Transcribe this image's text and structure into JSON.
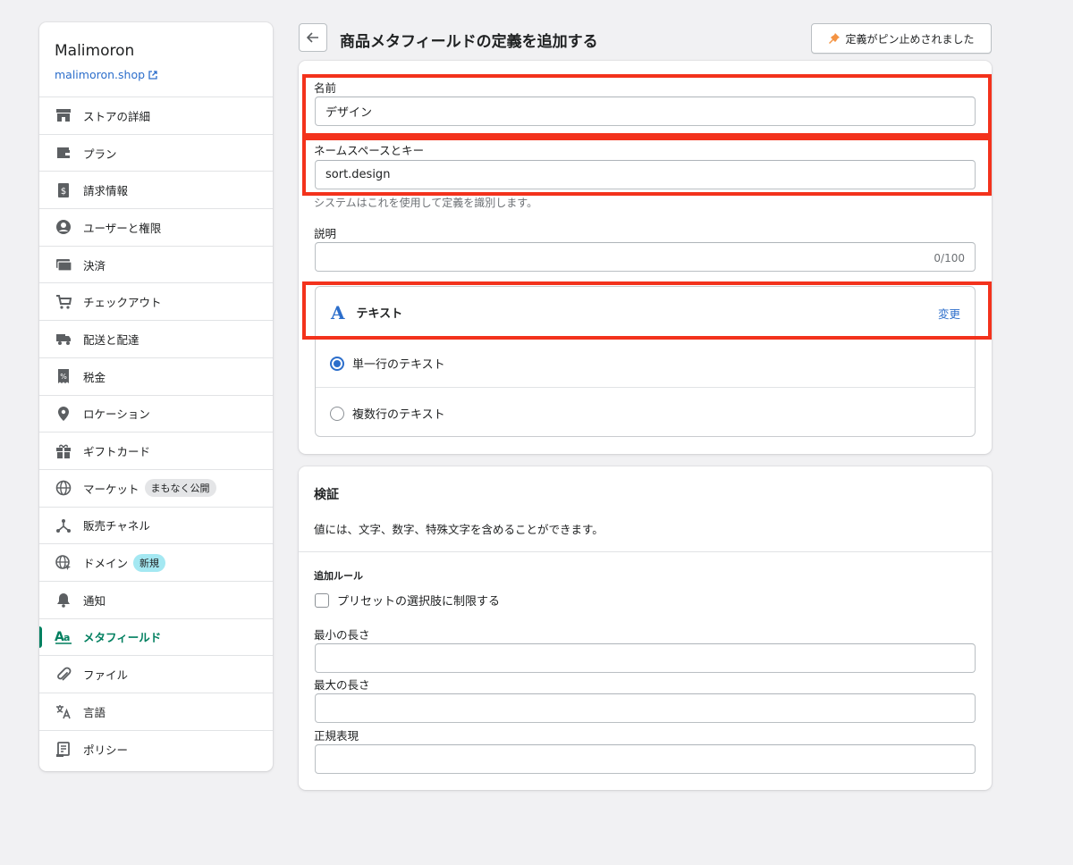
{
  "sidebar": {
    "store_name": "Malimoron",
    "store_link": "malimoron.shop",
    "items": [
      {
        "label": "ストアの詳細",
        "icon": "store-icon"
      },
      {
        "label": "プラン",
        "icon": "wallet-icon"
      },
      {
        "label": "請求情報",
        "icon": "billing-icon"
      },
      {
        "label": "ユーザーと権限",
        "icon": "user-circle-icon"
      },
      {
        "label": "決済",
        "icon": "payments-icon"
      },
      {
        "label": "チェックアウト",
        "icon": "cart-icon"
      },
      {
        "label": "配送と配達",
        "icon": "truck-icon"
      },
      {
        "label": "税金",
        "icon": "receipt-icon"
      },
      {
        "label": "ロケーション",
        "icon": "location-pin-icon"
      },
      {
        "label": "ギフトカード",
        "icon": "gift-icon"
      },
      {
        "label": "マーケット",
        "icon": "globe-icon",
        "badge": "まもなく公開"
      },
      {
        "label": "販売チャネル",
        "icon": "channels-icon"
      },
      {
        "label": "ドメイン",
        "icon": "domain-globe-icon",
        "badge": "新規"
      },
      {
        "label": "通知",
        "icon": "bell-icon"
      },
      {
        "label": "メタフィールド",
        "icon": "metafields-icon",
        "active": true
      },
      {
        "label": "ファイル",
        "icon": "paperclip-icon"
      },
      {
        "label": "言語",
        "icon": "translate-icon"
      },
      {
        "label": "ポリシー",
        "icon": "policy-icon"
      }
    ]
  },
  "header": {
    "title": "商品メタフィールドの定義を追加する",
    "pinned_label": "定義がピン止めされました"
  },
  "definition": {
    "name_label": "名前",
    "name_value": "デザイン",
    "key_label": "ネームスペースとキー",
    "key_value": "sort.design",
    "key_help": "システムはこれを使用して定義を識別します。",
    "description_label": "説明",
    "description_value": "",
    "description_counter": "0/100",
    "type_glyph": "A",
    "type_name": "テキスト",
    "type_change": "変更",
    "options": [
      {
        "label": "単一行のテキスト",
        "checked": true
      },
      {
        "label": "複数行のテキスト",
        "checked": false
      }
    ]
  },
  "validation": {
    "title": "検証",
    "description": "値には、文字、数字、特殊文字を含めることができます。",
    "rules_heading": "追加ルール",
    "preset_checkbox_label": "プリセットの選択肢に制限する",
    "preset_checked": false,
    "min_length_label": "最小の長さ",
    "min_length_value": "",
    "max_length_label": "最大の長さ",
    "max_length_value": "",
    "regex_label": "正規表現",
    "regex_value": ""
  },
  "colors": {
    "accent": "#2c6ecb",
    "active_nav": "#008060",
    "highlight": "#f3321c",
    "pin": "#f49342"
  }
}
